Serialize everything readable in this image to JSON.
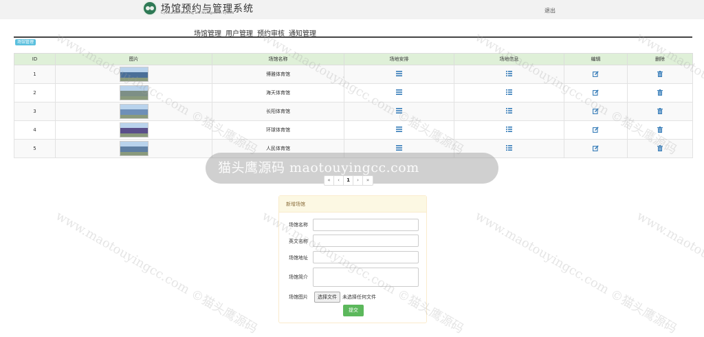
{
  "header": {
    "title": "场馆预约与管理系统",
    "subtitle": "Gymnasium Booking and Management System",
    "logout": "退出"
  },
  "nav": {
    "items": [
      "场馆管理",
      "用户管理",
      "预约审核",
      "通知管理"
    ]
  },
  "section_badge": "场馆管理",
  "table": {
    "columns": [
      "ID",
      "图片",
      "场馆名称",
      "场地安排",
      "场地信息",
      "编辑",
      "删除"
    ],
    "rows": [
      {
        "id": "1",
        "name": "博雅体育馆",
        "thumb_color": "#4a6f98"
      },
      {
        "id": "2",
        "name": "海天体育馆",
        "thumb_color": "#7d8f86"
      },
      {
        "id": "3",
        "name": "长阳体育馆",
        "thumb_color": "#6e8fb8"
      },
      {
        "id": "4",
        "name": "环球体育馆",
        "thumb_color": "#5a4f8a"
      },
      {
        "id": "5",
        "name": "人民体育馆",
        "thumb_color": "#5f7fa3"
      }
    ]
  },
  "icons": {
    "arrange": "list-icon",
    "info": "list-ul-icon",
    "edit": "edit-icon",
    "delete": "trash-icon"
  },
  "colors": {
    "header_bg": "#dff0d8",
    "icon_blue": "#337ab7",
    "badge": "#5bc0de",
    "submit": "#5cb85c"
  },
  "pagination": [
    "«",
    "‹",
    "1",
    "›",
    "»"
  ],
  "watermark_bar": "猫头鹰源码 maotouyingcc.com",
  "watermark": "www.maotouyingcc.com ©猫头鹰源码",
  "form": {
    "title": "新增场馆",
    "fields": [
      {
        "label": "场馆名称",
        "value": ""
      },
      {
        "label": "英文名称",
        "value": ""
      },
      {
        "label": "场馆地址",
        "value": ""
      },
      {
        "label": "场馆简介",
        "value": ""
      }
    ],
    "image_label": "场馆图片",
    "file_button": "选择文件",
    "file_hint": "未选择任何文件",
    "submit": "提交"
  }
}
